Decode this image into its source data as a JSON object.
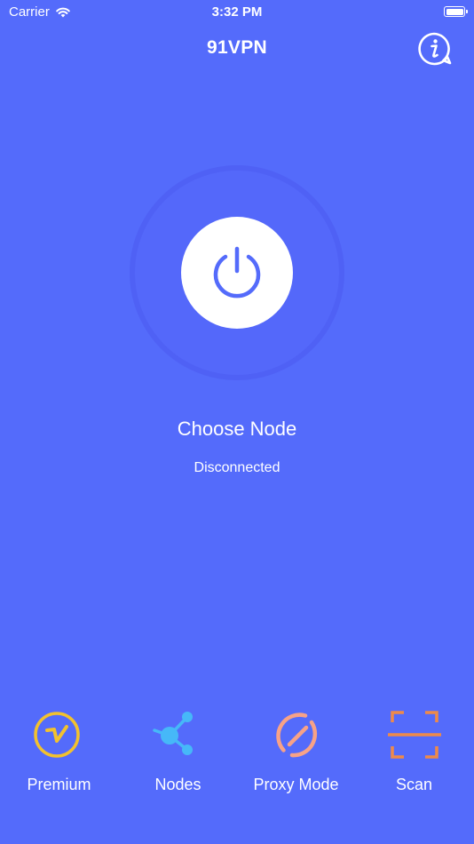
{
  "status_bar": {
    "carrier": "Carrier",
    "time": "3:32 PM",
    "icons": [
      "wifi-icon",
      "battery-icon"
    ]
  },
  "header": {
    "title": "91VPN",
    "info_icon": "info-icon"
  },
  "main": {
    "power_icon": "power-icon",
    "choose_node_label": "Choose Node",
    "status": "Disconnected"
  },
  "tabs": [
    {
      "label": "Premium",
      "icon": "premium-icon",
      "color": "#F2C12E"
    },
    {
      "label": "Nodes",
      "icon": "nodes-icon",
      "color": "#46B8F8"
    },
    {
      "label": "Proxy Mode",
      "icon": "proxy-mode-icon",
      "color": "#F7A287"
    },
    {
      "label": "Scan",
      "icon": "scan-icon",
      "color": "#EE8A49"
    }
  ],
  "colors": {
    "background": "#546BFB",
    "ring": "#4F61F5",
    "power_icon": "#546BFB",
    "text": "#FFFFFF"
  }
}
